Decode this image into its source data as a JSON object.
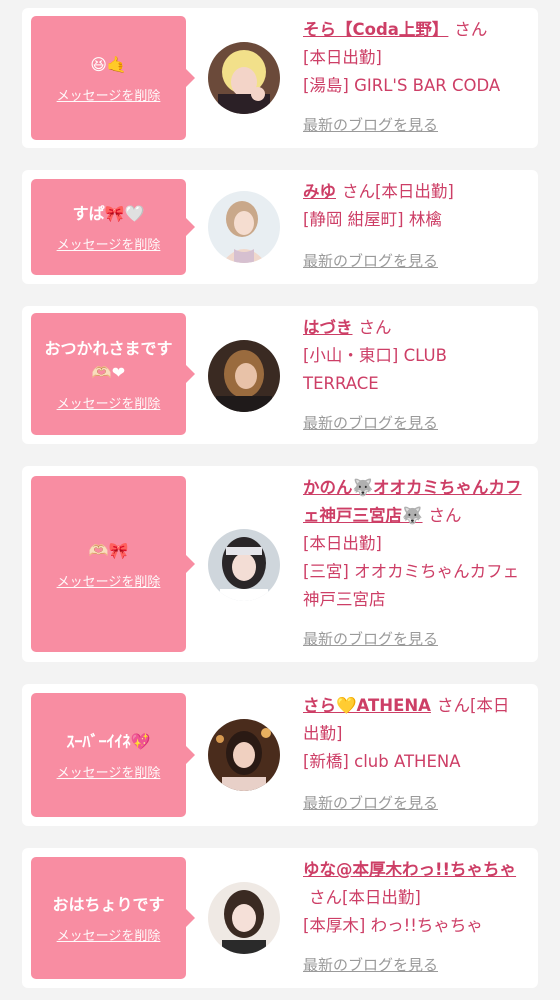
{
  "delete_label": "メッセージを削除",
  "honorific": "さん",
  "blog_label": "最新のブログを見る",
  "colors": {
    "accent": "#cd3e66",
    "bubble": "#f88da2",
    "background": "#f3f3f3",
    "link_gray": "#9a9a9a"
  },
  "messages": [
    {
      "message": "😆🤙",
      "name": "そら【Coda上野】",
      "status": "",
      "shop": "[本日出勤]\n[湯島] GIRL'S BAR CODA"
    },
    {
      "message": "すぱ🎀🤍",
      "name": "みゆ",
      "status": "[本日出勤]",
      "shop": "[静岡 紺屋町] 林檎"
    },
    {
      "message": "おつかれさまです\n🫶🏻❤",
      "name": "はづき",
      "status": "",
      "shop": "[小山・東口] CLUB TERRACE"
    },
    {
      "message": "🫶🏻🎀",
      "name": "かのん🐺オオカミちゃんカフェ神戸三宮店🐺",
      "status": "",
      "shop": "[本日出勤]\n[三宮] オオカミちゃんカフェ神戸三宮店"
    },
    {
      "message": "ｽｰﾊﾞｰｲｲﾈ💖",
      "name": "さら💛ATHENA",
      "status": "[本日出勤]",
      "shop": "[新橋] club ATHENA"
    },
    {
      "message": "おはちょりです",
      "name": "ゆな@本厚木わっ!!ちゃちゃ",
      "status": "[本日出勤]",
      "shop": "[本厚木] わっ!!ちゃちゃ"
    }
  ]
}
